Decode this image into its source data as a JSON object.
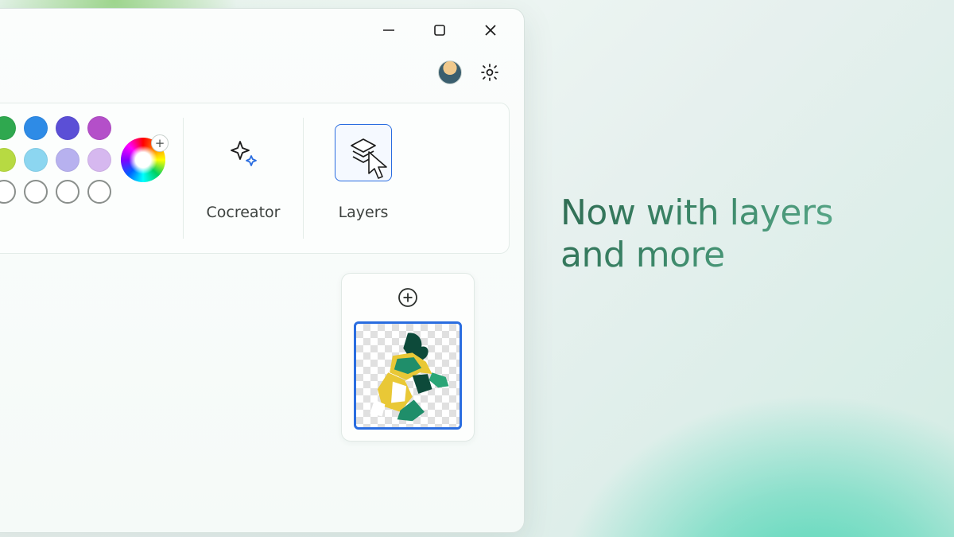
{
  "window": {
    "controls": {
      "minimize": "minimize",
      "maximize": "maximize",
      "close": "close"
    },
    "settings_icon": "settings",
    "avatar": "user-avatar"
  },
  "ribbon": {
    "colors": {
      "row1": [
        "#2fa84f",
        "#2e8be6",
        "#5b4fd6",
        "#b44fc9"
      ],
      "row2": [
        "#b7da42",
        "#8cd6f0",
        "#b7b1ef",
        "#d6b8ef"
      ],
      "row3_empty_count": 4,
      "picker_plus": "+"
    },
    "groups": [
      {
        "id": "cocreator",
        "label": "Cocreator",
        "icon": "sparkle",
        "selected": false
      },
      {
        "id": "layers",
        "label": "Layers",
        "icon": "layers",
        "selected": true
      }
    ]
  },
  "layers_panel": {
    "add_label": "+",
    "selected_layer": {
      "description": "figure-artwork",
      "transparent_bg": true
    }
  },
  "marketing": {
    "headline_line1": "Now with layers",
    "headline_line2": "and more"
  }
}
